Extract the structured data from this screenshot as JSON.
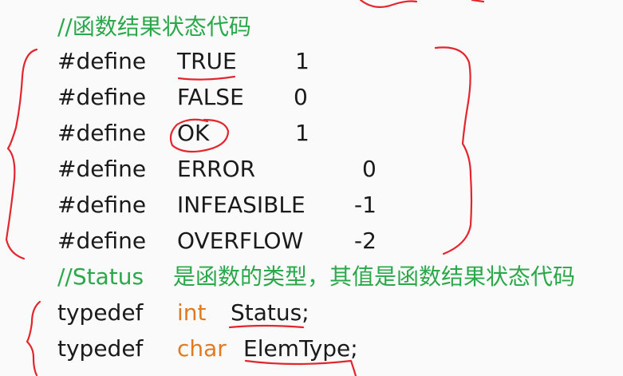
{
  "comment_status_codes": "//函数结果状态代码",
  "defines": [
    {
      "keyword": "#define",
      "name": "TRUE",
      "value": "1"
    },
    {
      "keyword": "#define",
      "name": "FALSE",
      "value": "0"
    },
    {
      "keyword": "#define",
      "name": "OK",
      "value": "1"
    },
    {
      "keyword": "#define",
      "name": "ERROR",
      "value": "0"
    },
    {
      "keyword": "#define",
      "name": "INFEASIBLE",
      "value": "-1"
    },
    {
      "keyword": "#define",
      "name": "OVERFLOW",
      "value": "-2"
    }
  ],
  "comment_status_type": {
    "prefix": "//Status",
    "text": "是函数的类型，其值是函数结果状态代码"
  },
  "typedefs": [
    {
      "keyword": "typedef",
      "type": "int",
      "name": "Status;"
    },
    {
      "keyword": "typedef",
      "type": "char",
      "name": "ElemType;"
    }
  ],
  "colors": {
    "comment": "#2aa84a",
    "code": "#1a1a1a",
    "type_keyword": "#e07b22",
    "annotation_ink": "#e3262e",
    "background": "#fafafa"
  }
}
